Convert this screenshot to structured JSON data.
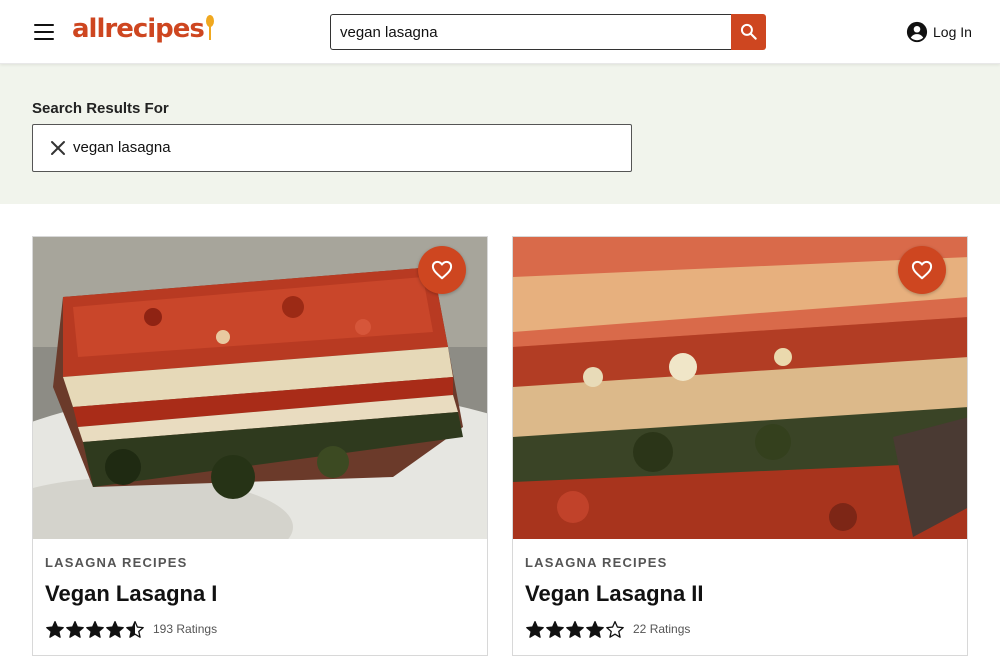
{
  "header": {
    "logo_text": "allrecipes",
    "search_value": "vegan lasagna",
    "login_label": "Log In",
    "brand_color": "#ce4620"
  },
  "search_results": {
    "title": "Search Results For",
    "query": "vegan lasagna"
  },
  "cards": [
    {
      "category": "LASAGNA RECIPES",
      "title": "Vegan Lasagna I",
      "rating": 4.5,
      "rating_count": "193",
      "rating_label": "Ratings",
      "image": "lasagna-on-plate"
    },
    {
      "category": "LASAGNA RECIPES",
      "title": "Vegan Lasagna II",
      "rating": 4,
      "rating_count": "22",
      "rating_label": "Ratings",
      "image": "lasagna-closeup"
    }
  ],
  "icons": {
    "menu": "hamburger-menu-icon",
    "search": "search-icon",
    "account": "account-circle-icon",
    "clear": "close-icon",
    "favorite": "heart-outline-icon",
    "star": "star-icon"
  }
}
